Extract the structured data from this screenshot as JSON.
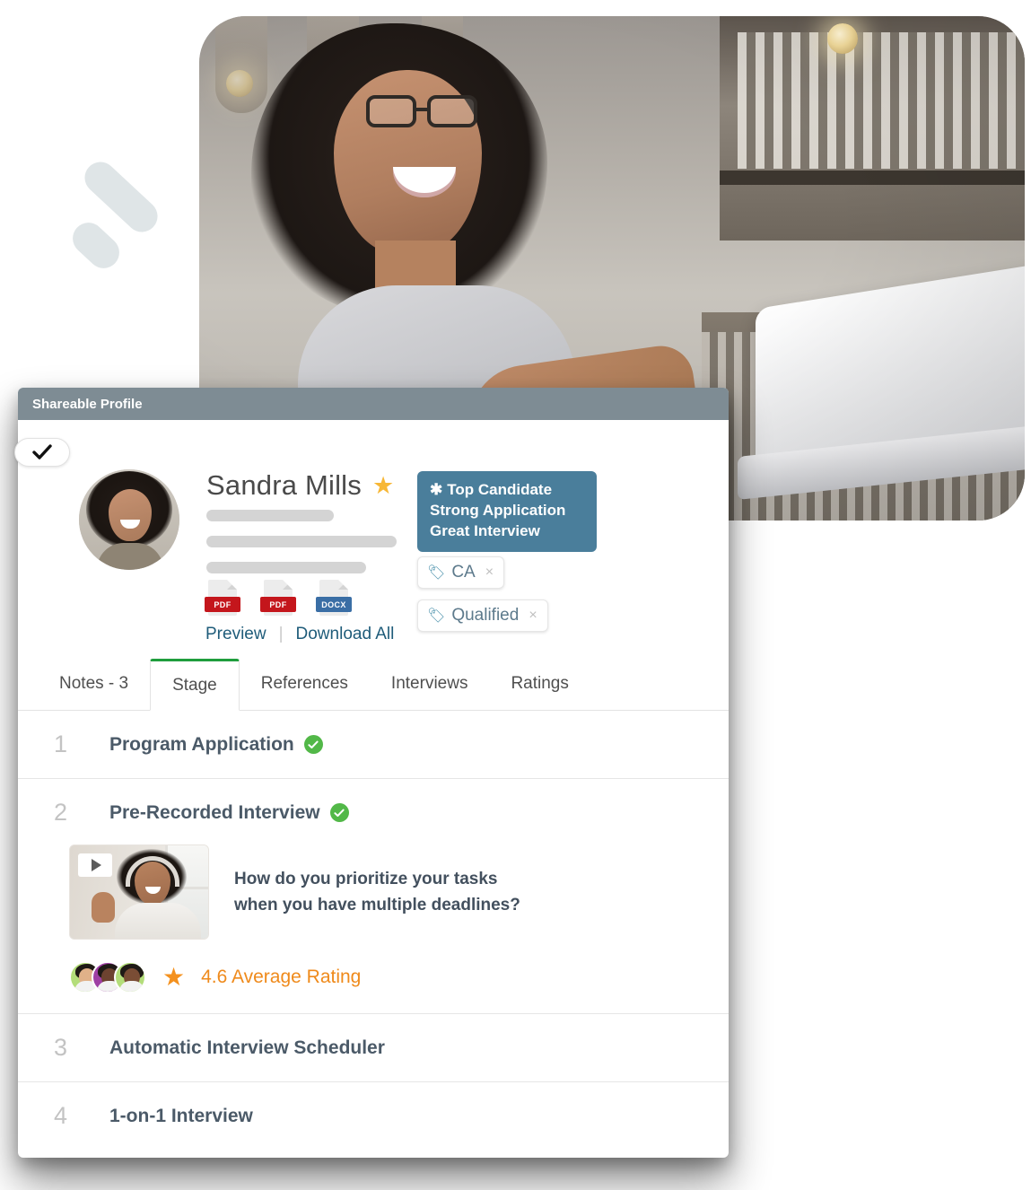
{
  "decor": {
    "mark_name": "double-slash-decoration"
  },
  "hero_photo": {
    "alt": "smiling-woman-with-laptop-in-cafe"
  },
  "card": {
    "header_title": "Shareable Profile",
    "header_color": "#7e8c94",
    "select_check_icon": "check-icon"
  },
  "profile": {
    "name": "Sandra Mills",
    "star_icon": "star-icon",
    "avatar_alt": "sandra-mills-avatar",
    "placeholder_bars": 3,
    "files": [
      {
        "type": "PDF",
        "label": "PDF",
        "color": "#c4161c"
      },
      {
        "type": "PDF",
        "label": "PDF",
        "color": "#c4161c"
      },
      {
        "type": "DOCX",
        "label": "DOCX",
        "color": "#3a6ea5"
      }
    ],
    "links": {
      "preview": "Preview",
      "separator": "|",
      "download_all": "Download All"
    },
    "badge": {
      "icon": "✳",
      "background": "#4a7e9b",
      "lines": [
        "Top Candidate",
        "Strong Application",
        "Great Interview"
      ]
    },
    "tags": [
      {
        "icon": "tag-icon",
        "label": "CA",
        "remove": "×"
      },
      {
        "icon": "tag-icon",
        "label": "Qualified",
        "remove": "×"
      }
    ]
  },
  "tabs": {
    "active_color": "#1f9d3d",
    "items": [
      {
        "label": "Notes - 3",
        "active": false
      },
      {
        "label": "Stage",
        "active": true
      },
      {
        "label": "References",
        "active": false
      },
      {
        "label": "Interviews",
        "active": false
      },
      {
        "label": "Ratings",
        "active": false
      }
    ]
  },
  "stages": [
    {
      "number": "1",
      "title": "Program Application",
      "complete": true
    },
    {
      "number": "2",
      "title": "Pre-Recorded Interview",
      "complete": true,
      "question": {
        "line1": "How do you prioritize your tasks",
        "line2": "when you have multiple deadlines?",
        "thumb_alt": "pre-recorded-interview-video-thumbnail",
        "play_icon": "play-icon"
      },
      "rating": {
        "star_icon": "star-icon",
        "text": "4.6 Average Rating",
        "value": "4.6",
        "color": "#ef8a1b",
        "reviewers": [
          {
            "ring": "#b3dd7a",
            "skin": "#e0b189"
          },
          {
            "ring": "#9e3fa4",
            "skin": "#6d4330"
          },
          {
            "ring": "#b3dd7a",
            "skin": "#7a4d35"
          }
        ]
      }
    },
    {
      "number": "3",
      "title": "Automatic Interview Scheduler",
      "complete": false
    },
    {
      "number": "4",
      "title": "1-on-1 Interview",
      "complete": false
    }
  ]
}
